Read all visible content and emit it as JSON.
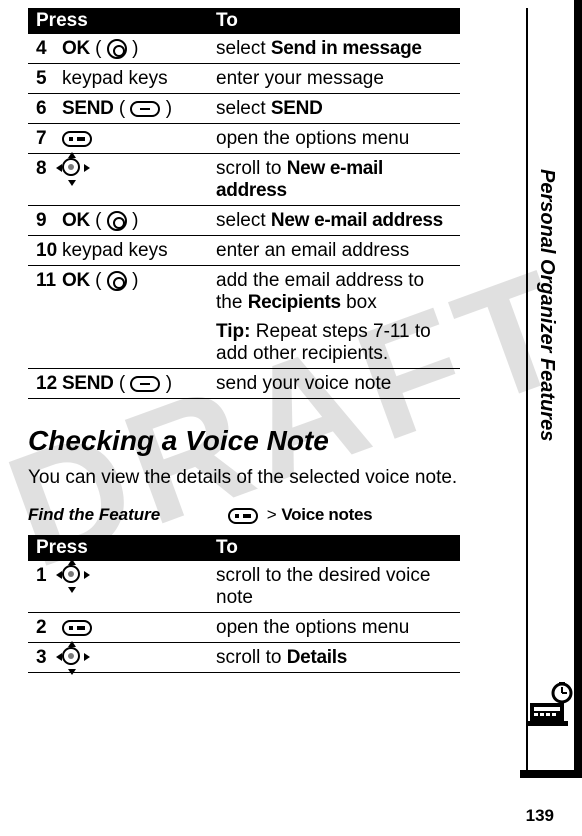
{
  "watermark": "DRAFT",
  "side_label": "Personal Organizer Features",
  "page_number": "139",
  "table1": {
    "header_press": "Press",
    "header_to": "To",
    "rows": [
      {
        "num": "4",
        "key": "OK",
        "icon": "center",
        "to_pre": "select ",
        "to_b": "Send in message"
      },
      {
        "num": "5",
        "key": "keypad keys",
        "icon": "",
        "to_pre": "enter your message",
        "to_b": ""
      },
      {
        "num": "6",
        "key": "SEND",
        "icon": "dash",
        "to_pre": "select ",
        "to_b": "SEND"
      },
      {
        "num": "7",
        "key": "",
        "icon": "menu",
        "to_pre": "open the options menu",
        "to_b": ""
      },
      {
        "num": "8",
        "key": "",
        "icon": "nav",
        "to_pre": "scroll to ",
        "to_b": "New e-mail address"
      },
      {
        "num": "9",
        "key": "OK",
        "icon": "center",
        "to_pre": "select ",
        "to_b": "New e-mail address"
      },
      {
        "num": "10",
        "key": "keypad keys",
        "icon": "",
        "to_pre": "enter an email address",
        "to_b": ""
      },
      {
        "num": "11",
        "key": "OK",
        "icon": "center",
        "to_pre": "add the email address to the ",
        "to_b": "Recipients",
        "to_post": " box"
      },
      {
        "tip_label": "Tip:",
        "tip_text": " Repeat steps 7-11 to add other recipients."
      },
      {
        "num": "12",
        "key": "SEND",
        "icon": "dash",
        "to_pre": "send your voice note",
        "to_b": ""
      }
    ]
  },
  "heading": "Checking a Voice Note",
  "intro": "You can view the details of the selected voice note.",
  "find_label": "Find the Feature",
  "find_path_sep": ">",
  "find_path_item": "Voice notes",
  "table2": {
    "header_press": "Press",
    "header_to": "To",
    "rows": [
      {
        "num": "1",
        "icon": "nav",
        "to_pre": "scroll to the desired voice note",
        "to_b": ""
      },
      {
        "num": "2",
        "icon": "menu",
        "to_pre": "open the options menu",
        "to_b": ""
      },
      {
        "num": "3",
        "icon": "nav",
        "to_pre": "scroll to ",
        "to_b": "Details"
      }
    ]
  }
}
